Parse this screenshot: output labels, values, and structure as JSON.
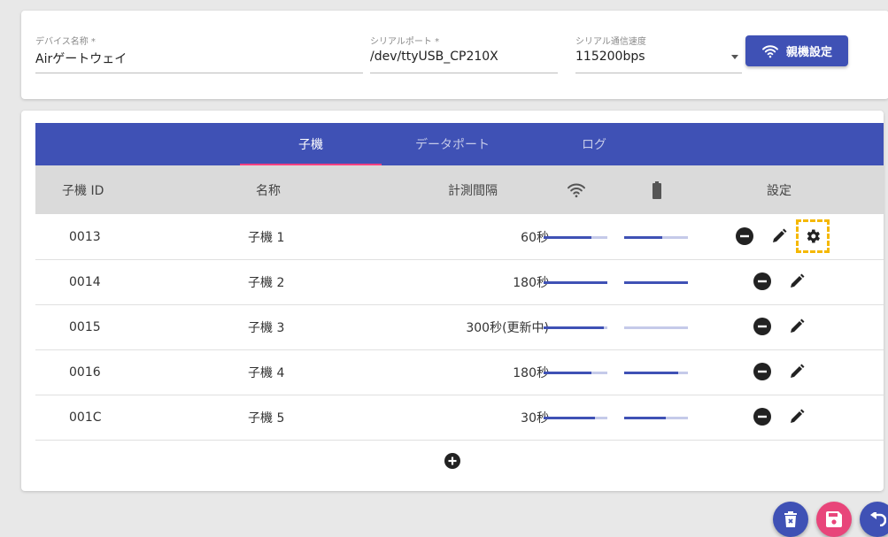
{
  "settings": {
    "device_name": {
      "label": "デバイス名称 *",
      "value": "Airゲートウェイ"
    },
    "serial_port": {
      "label": "シリアルポート *",
      "value": "/dev/ttyUSB_CP210X"
    },
    "serial_speed": {
      "label": "シリアル通信速度",
      "value": "115200bps"
    },
    "parent_button_label": "親機設定"
  },
  "tabs": [
    {
      "label": "子機",
      "active": true
    },
    {
      "label": "データポート",
      "active": false
    },
    {
      "label": "ログ",
      "active": false
    }
  ],
  "table": {
    "headers": {
      "id": "子機 ID",
      "name": "名称",
      "interval": "計測間隔",
      "signal_icon": "wifi-icon",
      "battery_icon": "battery-icon",
      "settings": "設定"
    },
    "rows": [
      {
        "id": "0013",
        "name": "子機 1",
        "interval": "60秒",
        "signal": 0.75,
        "battery": 0.6,
        "has_gear": true
      },
      {
        "id": "0014",
        "name": "子機 2",
        "interval": "180秒",
        "signal": 1.0,
        "battery": 1.0,
        "has_gear": false
      },
      {
        "id": "0015",
        "name": "子機 3",
        "interval": "300秒(更新中)",
        "signal": 0.95,
        "battery": 0.0,
        "has_gear": false
      },
      {
        "id": "0016",
        "name": "子機 4",
        "interval": "180秒",
        "signal": 0.75,
        "battery": 0.85,
        "has_gear": false
      },
      {
        "id": "001C",
        "name": "子機 5",
        "interval": "30秒",
        "signal": 0.8,
        "battery": 0.65,
        "has_gear": false
      }
    ]
  },
  "colors": {
    "primary": "#3f51b5",
    "accent": "#ff4081",
    "save": "#e8457a",
    "highlight": "#f5b800"
  },
  "fabs": [
    "delete-icon",
    "save-icon",
    "undo-icon"
  ]
}
